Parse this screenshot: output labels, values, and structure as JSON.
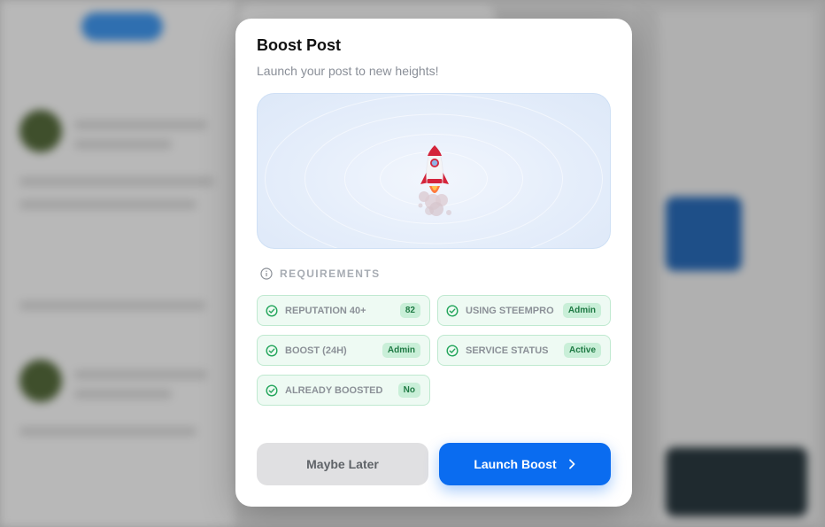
{
  "modal": {
    "title": "Boost Post",
    "subtitle": "Launch your post to new heights!",
    "hero_icon": "rocket-icon"
  },
  "requirements": {
    "title": "REQUIREMENTS",
    "items": [
      {
        "label": "REPUTATION 40+",
        "value": "82"
      },
      {
        "label": "USING STEEMPRO",
        "value": "Admin"
      },
      {
        "label": "BOOST (24H)",
        "value": "Admin"
      },
      {
        "label": "SERVICE STATUS",
        "value": "Active"
      },
      {
        "label": "ALREADY BOOSTED",
        "value": "No"
      }
    ]
  },
  "actions": {
    "later_label": "Maybe Later",
    "launch_label": "Launch Boost"
  },
  "colors": {
    "accent": "#0a6cf0",
    "success": "#22a55a",
    "success_bg": "#eefaf3"
  }
}
